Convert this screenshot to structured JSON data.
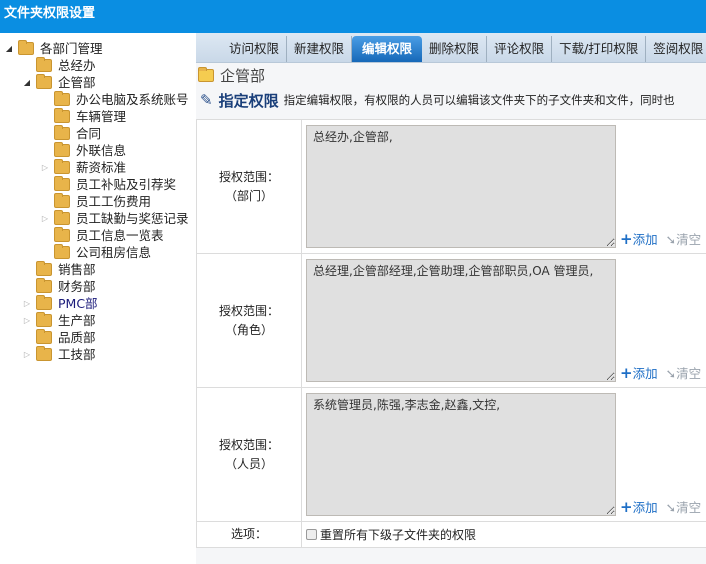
{
  "window": {
    "title": "文件夹权限设置"
  },
  "tree": [
    {
      "label": "各部门管理",
      "level": 0,
      "state": "open"
    },
    {
      "label": "总经办",
      "level": 1,
      "state": "none"
    },
    {
      "label": "企管部",
      "level": 1,
      "state": "open"
    },
    {
      "label": "办公电脑及系统账号",
      "level": 2,
      "state": "none"
    },
    {
      "label": "车辆管理",
      "level": 2,
      "state": "none"
    },
    {
      "label": "合同",
      "level": 2,
      "state": "none"
    },
    {
      "label": "外联信息",
      "level": 2,
      "state": "none"
    },
    {
      "label": "薪资标准",
      "level": 2,
      "state": "closed"
    },
    {
      "label": "员工补贴及引荐奖",
      "level": 2,
      "state": "none"
    },
    {
      "label": "员工工伤费用",
      "level": 2,
      "state": "none"
    },
    {
      "label": "员工缺勤与奖惩记录",
      "level": 2,
      "state": "closed"
    },
    {
      "label": "员工信息一览表",
      "level": 2,
      "state": "none"
    },
    {
      "label": "公司租房信息",
      "level": 2,
      "state": "none"
    },
    {
      "label": "销售部",
      "level": 1,
      "state": "none"
    },
    {
      "label": "财务部",
      "level": 1,
      "state": "none"
    },
    {
      "label": "PMC部",
      "level": 1,
      "state": "closed"
    },
    {
      "label": "生产部",
      "level": 1,
      "state": "closed"
    },
    {
      "label": "品质部",
      "level": 1,
      "state": "none"
    },
    {
      "label": "工技部",
      "level": 1,
      "state": "closed"
    }
  ],
  "tabs": [
    {
      "label": "访问权限"
    },
    {
      "label": "新建权限"
    },
    {
      "label": "编辑权限",
      "active": true
    },
    {
      "label": "删除权限"
    },
    {
      "label": "评论权限"
    },
    {
      "label": "下载/打印权限"
    },
    {
      "label": "签阅权限"
    }
  ],
  "folder": "企管部",
  "section": {
    "title": "指定权限",
    "description": "指定编辑权限，有权限的人员可以编辑该文件夹下的子文件夹和文件，同时也"
  },
  "rows": [
    {
      "label": "授权范围：",
      "sub": "（部门）",
      "value": "总经办,企管部,"
    },
    {
      "label": "授权范围：",
      "sub": "（角色）",
      "value": "总经理,企管部经理,企管助理,企管部职员,OA 管理员,"
    },
    {
      "label": "授权范围：",
      "sub": "（人员）",
      "value": "系统管理员,陈强,李志金,赵鑫,文控,"
    }
  ],
  "actions": {
    "add": "添加",
    "clear": "清空"
  },
  "options": {
    "label": "选项：",
    "checkbox": "重置所有下级子文件夹的权限",
    "checked": false
  }
}
